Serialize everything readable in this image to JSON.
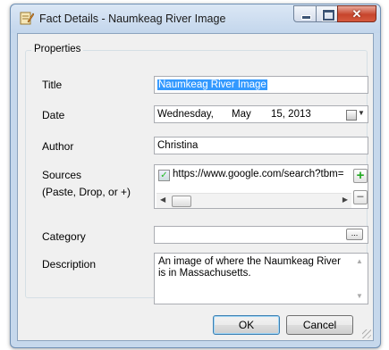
{
  "window": {
    "title": "Fact Details - Naumkeag River Image"
  },
  "properties_group": {
    "title": "Properties"
  },
  "fields": {
    "title_label": "Title",
    "title_value": "Naumkeag River Image",
    "date_label": "Date",
    "date_weekday": "Wednesday,",
    "date_month": "May",
    "date_day_year": "15, 2013",
    "author_label": "Author",
    "author_value": "Christina",
    "sources_label": "Sources",
    "sources_hint": "(Paste, Drop, or +)",
    "source_url": "https://www.google.com/search?tbm=",
    "source_checked": true,
    "category_label": "Category",
    "category_value": "",
    "category_browse": "...",
    "description_label": "Description",
    "description_value": "An image of where the Naumkeag River is in Massachusetts."
  },
  "buttons": {
    "ok": "OK",
    "cancel": "Cancel",
    "add": "+",
    "remove": "−"
  },
  "icons": {
    "title_icon": "notepad-pencil-icon",
    "calendar": "calendar-dropdown-icon"
  },
  "colors": {
    "selection": "#3399ff",
    "add_green": "#22aa22"
  }
}
